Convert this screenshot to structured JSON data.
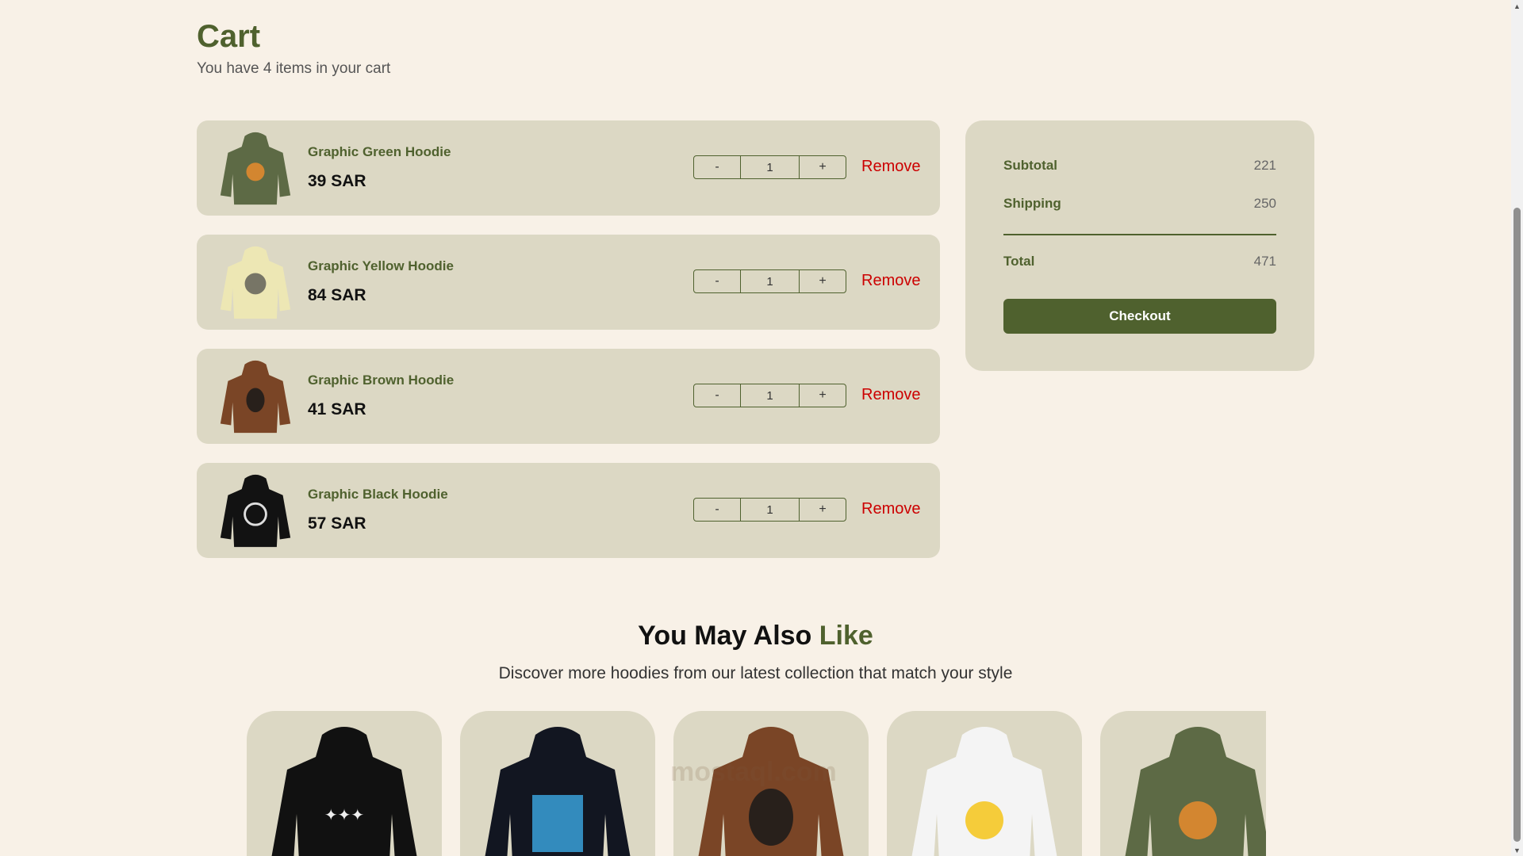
{
  "header": {
    "title": "Cart",
    "subtitle": "You have 4 items in your cart"
  },
  "cart": {
    "items": [
      {
        "name": "Graphic Green Hoodie",
        "price": "39 SAR",
        "qty": "1",
        "color": "#5d6a45"
      },
      {
        "name": "Graphic Yellow Hoodie",
        "price": "84 SAR",
        "qty": "1",
        "color": "#ede7b4"
      },
      {
        "name": "Graphic Brown Hoodie",
        "price": "41 SAR",
        "qty": "1",
        "color": "#7a4526"
      },
      {
        "name": "Graphic Black Hoodie",
        "price": "57 SAR",
        "qty": "1",
        "color": "#121212"
      }
    ],
    "minus_label": "-",
    "plus_label": "+",
    "remove_label": "Remove"
  },
  "summary": {
    "subtotal_label": "Subtotal",
    "subtotal": "221",
    "shipping_label": "Shipping",
    "shipping": "250",
    "total_label": "Total",
    "total": "471",
    "checkout_label": "Checkout"
  },
  "recommend": {
    "title": "You May Also",
    "title_accent": "Like",
    "subtitle": "Discover more hoodies from our latest collection that match your style",
    "items": [
      {
        "color": "#111111"
      },
      {
        "color": "#121621"
      },
      {
        "color": "#7a4526"
      },
      {
        "color": "#f4f4f4"
      },
      {
        "color": "#5d6a45"
      }
    ]
  },
  "watermark": "mostaql.com",
  "colors": {
    "accent": "#4f612e",
    "card_bg": "#dcd8c4",
    "page_bg": "#f8f1e7",
    "remove": "#cc0000"
  }
}
